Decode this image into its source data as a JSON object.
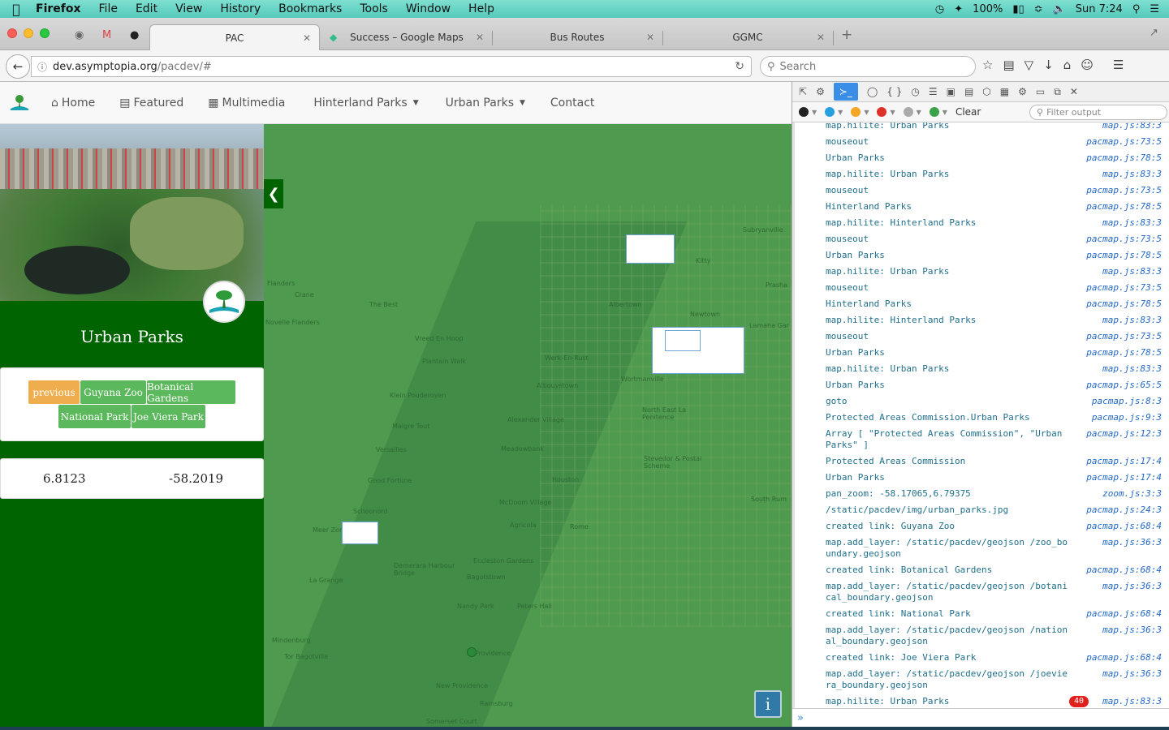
{
  "menubar": {
    "app": "Firefox",
    "items": [
      "File",
      "Edit",
      "View",
      "History",
      "Bookmarks",
      "Tools",
      "Window",
      "Help"
    ],
    "battery": "100%",
    "clock": "Sun 7:24"
  },
  "tabs": [
    {
      "label": "PAC"
    },
    {
      "label": "Success – Google Maps"
    },
    {
      "label": "Bus Routes"
    },
    {
      "label": "GGMC"
    }
  ],
  "navbar": {
    "url_host": "dev.asymptopia.org",
    "url_path": "/pacdev/#",
    "search_placeholder": "Search"
  },
  "site": {
    "nav": [
      {
        "label": "Home"
      },
      {
        "label": "Featured"
      },
      {
        "label": "Multimedia"
      },
      {
        "label": "Hinterland Parks"
      },
      {
        "label": "Urban Parks"
      },
      {
        "label": "Contact"
      }
    ],
    "sidebar": {
      "title": "Urban Parks",
      "buttons": [
        "previous",
        "Guyana Zoo",
        "Botanical Gardens",
        "National Park",
        "Joe Viera Park"
      ],
      "lat": "6.8123",
      "lon": "-58.2019"
    },
    "map_labels": [
      "Subryanville",
      "Kitty",
      "Prasha",
      "Lamaha Gar",
      "Newtown",
      "Albertown",
      "Werk-En-Rust",
      "Wortmanville",
      "Albouystown",
      "North East La Penitence",
      "Stevedor & Postal Scheme",
      "South Rum",
      "The Best",
      "Crane",
      "Vreed En Hoop",
      "Plantain Walk",
      "Klein Pouderoyen",
      "Malgre Tout",
      "Versailles",
      "Good Fortune",
      "Schoonord",
      "Meer Zorg",
      "Alexander Village",
      "Meadowbank",
      "Houston",
      "McDoom Village",
      "Agricola",
      "Rome",
      "Eccleston Gardens",
      "Bagotstown",
      "Nandy Park",
      "Peters Hall",
      "Providence",
      "La Grange",
      "Mindenburg",
      "Tor Bagotville",
      "New Providence",
      "Ramsburg",
      "Somerset Court",
      "Novelle Flanders",
      "Flanders",
      "Demerara Harbour Bridge"
    ],
    "info_label": "i"
  },
  "devtools": {
    "clear_label": "Clear",
    "filter_placeholder": "Filter output",
    "logs": [
      {
        "msg": "map.hilite: Urban Parks",
        "src": "map.js:83:3"
      },
      {
        "msg": "mouseout",
        "src": "pacmap.js:73:5"
      },
      {
        "msg": "Urban Parks",
        "src": "pacmap.js:78:5"
      },
      {
        "msg": "map.hilite: Urban Parks",
        "src": "map.js:83:3"
      },
      {
        "msg": "mouseout",
        "src": "pacmap.js:73:5"
      },
      {
        "msg": "Hinterland Parks",
        "src": "pacmap.js:78:5"
      },
      {
        "msg": "map.hilite: Hinterland Parks",
        "src": "map.js:83:3"
      },
      {
        "msg": "mouseout",
        "src": "pacmap.js:73:5"
      },
      {
        "msg": "Urban Parks",
        "src": "pacmap.js:78:5"
      },
      {
        "msg": "map.hilite: Urban Parks",
        "src": "map.js:83:3"
      },
      {
        "msg": "mouseout",
        "src": "pacmap.js:73:5"
      },
      {
        "msg": "Hinterland Parks",
        "src": "pacmap.js:78:5"
      },
      {
        "msg": "map.hilite: Hinterland Parks",
        "src": "map.js:83:3"
      },
      {
        "msg": "mouseout",
        "src": "pacmap.js:73:5"
      },
      {
        "msg": "Urban Parks",
        "src": "pacmap.js:78:5"
      },
      {
        "msg": "map.hilite: Urban Parks",
        "src": "map.js:83:3"
      },
      {
        "msg": "Urban Parks",
        "src": "pacmap.js:65:5"
      },
      {
        "msg": "goto",
        "src": "pacmap.js:8:3"
      },
      {
        "msg": "Protected Areas Commission.Urban Parks",
        "src": "pacmap.js:9:3"
      },
      {
        "msg": "Array [ \"Protected Areas Commission\", \"Urban Parks\" ]",
        "src": "pacmap.js:12:3"
      },
      {
        "msg": "Protected Areas Commission",
        "src": "pacmap.js:17:4"
      },
      {
        "msg": "Urban Parks",
        "src": "pacmap.js:17:4"
      },
      {
        "msg": "pan_zoom: -58.17065,6.79375",
        "src": "zoom.js:3:3"
      },
      {
        "msg": "/static/pacdev/img/urban_parks.jpg",
        "src": "pacmap.js:24:3"
      },
      {
        "msg": "created link: Guyana Zoo",
        "src": "pacmap.js:68:4"
      },
      {
        "msg": "map.add_layer: /static/pacdev/geojson /zoo_boundary.geojson",
        "src": "map.js:36:3"
      },
      {
        "msg": "created link: Botanical Gardens",
        "src": "pacmap.js:68:4"
      },
      {
        "msg": "map.add_layer: /static/pacdev/geojson /botanical_boundary.geojson",
        "src": "map.js:36:3"
      },
      {
        "msg": "created link: National Park",
        "src": "pacmap.js:68:4"
      },
      {
        "msg": "map.add_layer: /static/pacdev/geojson /national_boundary.geojson",
        "src": "map.js:36:3"
      },
      {
        "msg": "created link: Joe Viera Park",
        "src": "pacmap.js:68:4"
      },
      {
        "msg": "map.add_layer: /static/pacdev/geojson /joeviera_boundary.geojson",
        "src": "map.js:36:3"
      },
      {
        "msg": "map.hilite: Urban Parks",
        "src": "map.js:83:3",
        "count": "40"
      }
    ]
  },
  "colors": {
    "sidebar": "#006400",
    "map": "#4e9a4e",
    "btn_prev": "#f0ad4e",
    "btn_green": "#5cb85c",
    "menubar": "#5fd3c4"
  }
}
